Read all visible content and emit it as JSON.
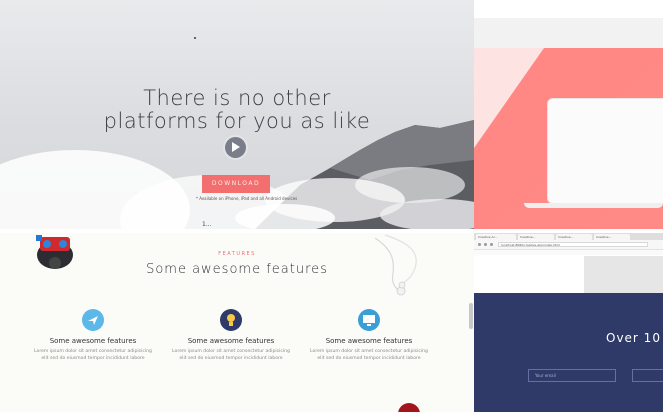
{
  "hero": {
    "title_line1": "There is no other",
    "title_line2": "platforms for you as like",
    "cta_label": "DOWNLOAD",
    "note": "* Available on iPhone, iPad and all Android devices",
    "small_text": "1..."
  },
  "features": {
    "kicker": "FEATURES",
    "title": "Some awesome features",
    "items": [
      {
        "title": "Some awesome features",
        "desc": "Lorem ipsum dolor sit amet consectetur adipisicing elit sed do eiusmod tempor incididunt labore",
        "icon": "plane-icon",
        "color": "#5bb8e8"
      },
      {
        "title": "Some awesome features",
        "desc": "Lorem ipsum dolor sit amet consectetur adipisicing elit sed do eiusmod tempor incididunt labore",
        "icon": "bulb-icon",
        "color": "#2f3a68"
      },
      {
        "title": "Some awesome features",
        "desc": "Lorem ipsum dolor sit amet consectetur adipisicing elit sed do eiusmod tempor incididunt labore",
        "icon": "monitor-icon",
        "color": "#3a9fd6"
      }
    ]
  },
  "browser": {
    "tabs": [
      "Creative Ar...",
      "Creative...",
      "Creative...",
      "Creative..."
    ],
    "address": "localhost:8080/creative-app/index.html"
  },
  "dark_section": {
    "title": "Over 10",
    "input_placeholder": "Your email"
  },
  "colors": {
    "accent": "#f36f6f",
    "coral": "#ff8783",
    "navy": "#2f3a68"
  }
}
